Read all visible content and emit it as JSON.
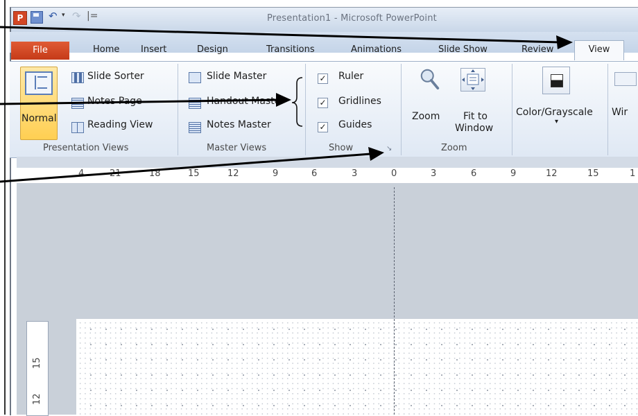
{
  "window": {
    "title": "Presentation1 - Microsoft PowerPoint",
    "app_icon": "powerpoint-icon",
    "qat_separator": "|="
  },
  "tabs": {
    "file": "File",
    "home": "Home",
    "insert": "Insert",
    "design": "Design",
    "transitions": "Transitions",
    "animations": "Animations",
    "slide_show": "Slide Show",
    "review": "Review",
    "view": "View"
  },
  "ribbon": {
    "presentation_views": {
      "normal": "Normal",
      "slide_sorter": "Slide Sorter",
      "notes_page": "Notes Page",
      "reading_view": "Reading View",
      "label": "Presentation Views"
    },
    "master_views": {
      "slide_master": "Slide Master",
      "handout_master": "Handout Master",
      "notes_master": "Notes Master",
      "label": "Master Views"
    },
    "show": {
      "ruler": "Ruler",
      "gridlines": "Gridlines",
      "guides": "Guides",
      "ruler_checked": true,
      "gridlines_checked": true,
      "guides_checked": true,
      "label": "Show",
      "check_glyph": "✓"
    },
    "zoom": {
      "zoom": "Zoom",
      "fit_line1": "Fit to",
      "fit_line2": "Window",
      "label": "Zoom"
    },
    "color": {
      "color_grayscale": "Color/Grayscale",
      "dropdown": "▾"
    },
    "window_partial": "Wir"
  },
  "ruler": {
    "horizontal": [
      "4",
      "21",
      "18",
      "15",
      "12",
      "9",
      "6",
      "3",
      "0",
      "3",
      "6",
      "9",
      "12",
      "15",
      "1"
    ],
    "vertical": [
      "15",
      "12"
    ]
  },
  "colors": {
    "file_tab": "#d24625",
    "selected_button": "#ffcf52",
    "ribbon_bg": "#dfe8f4",
    "editor_bg": "#c9d0d9"
  }
}
